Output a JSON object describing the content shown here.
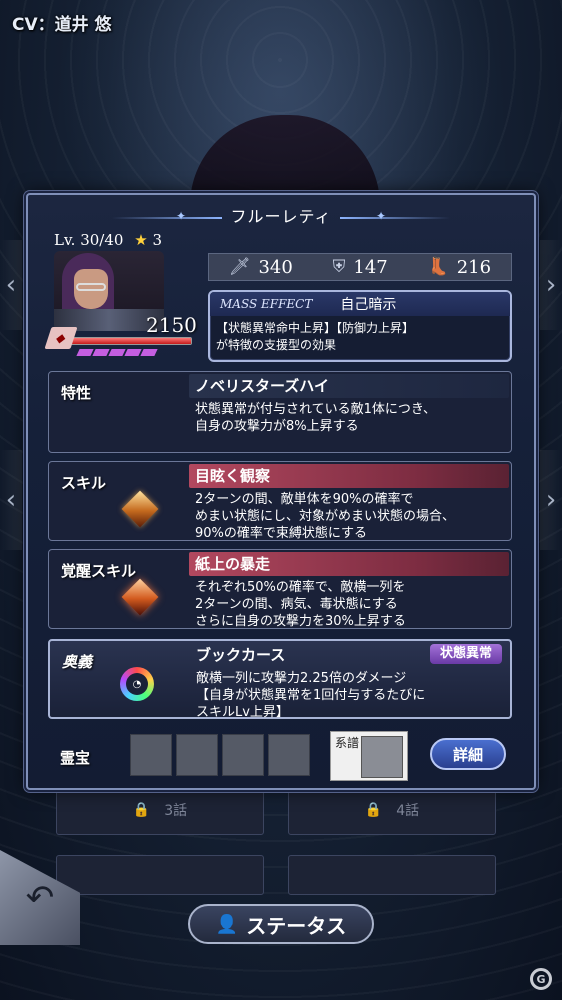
{
  "cv_label": "CV：道井 悠",
  "character": {
    "name": "フルーレティ",
    "level": "Lv. 30/40",
    "stars": "3",
    "power": "2150",
    "hp_fraction": 1.0,
    "awakening_pips": 5
  },
  "stats": {
    "attack": "340",
    "defense": "147",
    "speed": "216"
  },
  "mass_effect": {
    "tag": "MASS EFFECT",
    "name": "自己暗示",
    "desc_line1": "【状態異常命中上昇】【防御力上昇】",
    "desc_line2": "が特徴の支援型の効果"
  },
  "trait": {
    "label": "特性",
    "title": "ノベリスターズハイ",
    "desc_line1": "状態異常が付与されている敵1体につき、",
    "desc_line2": "自身の攻撃力が8%上昇する"
  },
  "skill": {
    "label": "スキル",
    "title": "目眩く観察",
    "desc_line1": "2ターンの間、敵単体を90%の確率で",
    "desc_line2": "めまい状態にし、対象がめまい状態の場合、",
    "desc_line3": "90%の確率で束縛状態にする"
  },
  "awake_skill": {
    "label": "覚醒スキル",
    "title": "紙上の暴走",
    "desc_line1": "それぞれ50%の確率で、敵横一列を",
    "desc_line2": "2ターンの間、病気、毒状態にする",
    "desc_line3": "さらに自身の攻撃力を30%上昇する"
  },
  "ougi": {
    "label": "奥義",
    "title": "ブックカース",
    "badge": "状態異常",
    "desc_line1": "敵横一列に攻撃力2.25倍のダメージ",
    "desc_line2": "【自身が状態異常を1回付与するたびに",
    "desc_line3": "スキルLv上昇】"
  },
  "treasure": {
    "label": "霊宝",
    "keifu_label": "系譜",
    "detail_button": "詳細"
  },
  "below": {
    "tile1": "3話",
    "tile2": "4話"
  },
  "status_button": "ステータス"
}
